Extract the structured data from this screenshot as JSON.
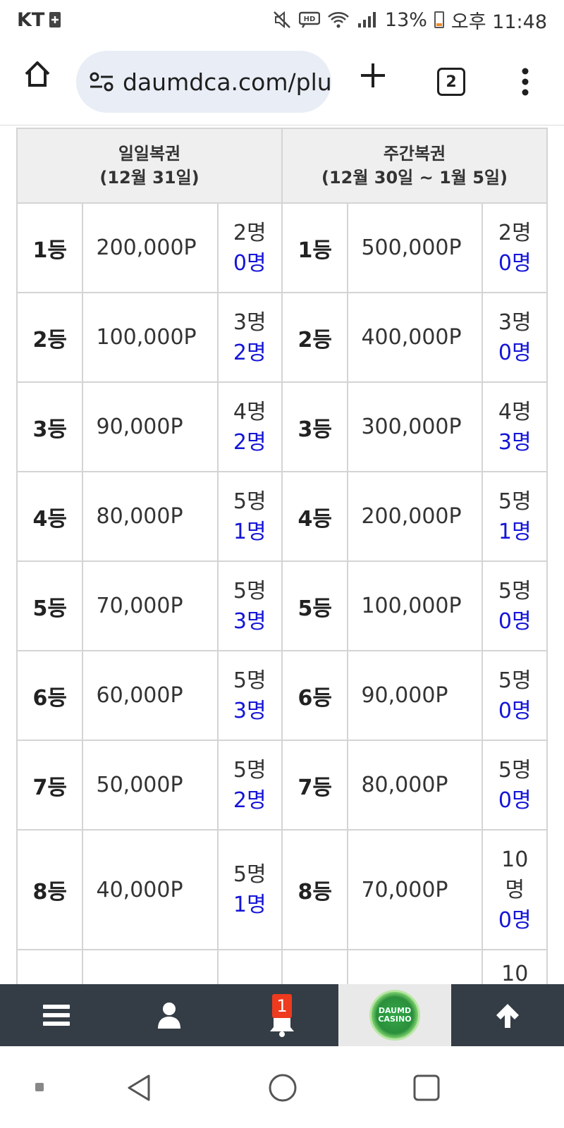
{
  "status_bar": {
    "carrier": "KT",
    "battery_percent": "13%",
    "time": "오후 11:48",
    "icons": [
      "sim-icon",
      "mute-icon",
      "hd-icon",
      "wifi-icon",
      "signal-icon",
      "battery-icon"
    ]
  },
  "browser": {
    "url": "daumdca.com/plu",
    "tab_count": "2",
    "icons": [
      "home-icon",
      "site-info-icon",
      "plus-icon",
      "tabs-icon",
      "more-vert-icon"
    ]
  },
  "table": {
    "headers": [
      {
        "line1": "일일복권",
        "line2": "(12월 31일)"
      },
      {
        "line1": "주간복권",
        "line2": "(12월 30일 ~ 1월 5일)"
      }
    ],
    "rows": [
      {
        "d_rank": "1등",
        "d_prize": "200,000P",
        "d_total": "2명",
        "d_won": "0명",
        "w_rank": "1등",
        "w_prize": "500,000P",
        "w_total": "2명",
        "w_won": "0명"
      },
      {
        "d_rank": "2등",
        "d_prize": "100,000P",
        "d_total": "3명",
        "d_won": "2명",
        "w_rank": "2등",
        "w_prize": "400,000P",
        "w_total": "3명",
        "w_won": "0명"
      },
      {
        "d_rank": "3등",
        "d_prize": "90,000P",
        "d_total": "4명",
        "d_won": "2명",
        "w_rank": "3등",
        "w_prize": "300,000P",
        "w_total": "4명",
        "w_won": "3명"
      },
      {
        "d_rank": "4등",
        "d_prize": "80,000P",
        "d_total": "5명",
        "d_won": "1명",
        "w_rank": "4등",
        "w_prize": "200,000P",
        "w_total": "5명",
        "w_won": "1명"
      },
      {
        "d_rank": "5등",
        "d_prize": "70,000P",
        "d_total": "5명",
        "d_won": "3명",
        "w_rank": "5등",
        "w_prize": "100,000P",
        "w_total": "5명",
        "w_won": "0명"
      },
      {
        "d_rank": "6등",
        "d_prize": "60,000P",
        "d_total": "5명",
        "d_won": "3명",
        "w_rank": "6등",
        "w_prize": "90,000P",
        "w_total": "5명",
        "w_won": "0명"
      },
      {
        "d_rank": "7등",
        "d_prize": "50,000P",
        "d_total": "5명",
        "d_won": "2명",
        "w_rank": "7등",
        "w_prize": "80,000P",
        "w_total": "5명",
        "w_won": "0명"
      },
      {
        "d_rank": "8등",
        "d_prize": "40,000P",
        "d_total": "5명",
        "d_won": "1명",
        "w_rank": "8등",
        "w_prize": "70,000P",
        "w_total_a": "10",
        "w_total_b": "명",
        "w_won": "0명"
      }
    ],
    "partial_row": {
      "w_total": "10"
    }
  },
  "bottom_nav": {
    "notification_count": "1",
    "logo_text_1": "DAUMD",
    "logo_text_2": "CASINO",
    "icons": [
      "menu-icon",
      "user-icon",
      "bell-icon",
      "logo-icon",
      "arrow-up-icon"
    ]
  },
  "colors": {
    "won_count": "#1515d8",
    "bottom_nav_bg": "#343d45",
    "badge": "#ee3a1e",
    "url_pill": "#e8edf6",
    "header_bg": "#efefef"
  }
}
